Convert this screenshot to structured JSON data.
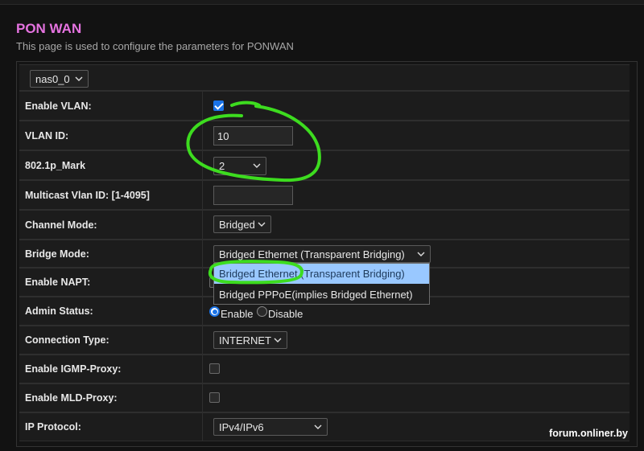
{
  "page": {
    "title": "PON WAN",
    "description": "This page is used to configure the parameters for PONWAN"
  },
  "interface_select": {
    "value": "nas0_0"
  },
  "fields": {
    "enable_vlan": {
      "label": "Enable VLAN:",
      "checked": true
    },
    "vlan_id": {
      "label": "VLAN ID:",
      "value": "10"
    },
    "mark_8021p": {
      "label": "802.1p_Mark",
      "value": "2"
    },
    "multicast_vlan": {
      "label": "Multicast Vlan ID: [1-4095]",
      "value": ""
    },
    "channel_mode": {
      "label": "Channel Mode:",
      "value": "Bridged"
    },
    "bridge_mode": {
      "label": "Bridge Mode:",
      "value": "Bridged Ethernet (Transparent Bridging)",
      "options": [
        "Bridged Ethernet (Transparent Bridging)",
        "Bridged PPPoE(implies Bridged Ethernet)"
      ]
    },
    "enable_napt": {
      "label": "Enable NAPT:"
    },
    "admin_status": {
      "label": "Admin Status:",
      "opt_enable": "Enable",
      "opt_disable": "Disable",
      "selected": "Enable"
    },
    "connection_type": {
      "label": "Connection Type:",
      "value": "INTERNET"
    },
    "igmp_proxy": {
      "label": "Enable IGMP-Proxy:",
      "checked": false
    },
    "mld_proxy": {
      "label": "Enable MLD-Proxy:",
      "checked": false
    },
    "ip_protocol": {
      "label": "IP Protocol:",
      "value": "IPv4/IPv6"
    }
  },
  "watermark": "forum.onliner.by",
  "colors": {
    "title": "#e573e0",
    "annotation": "#3ddc1f",
    "highlight": "#99c8ff",
    "accent": "#1a73e8"
  }
}
